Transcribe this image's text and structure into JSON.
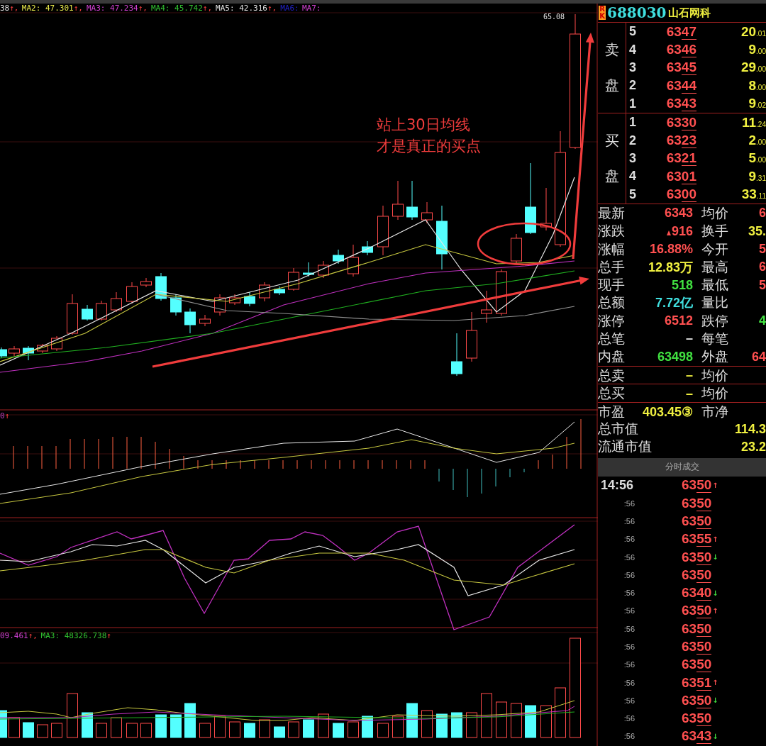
{
  "chart": {
    "legend": [
      {
        "label": "38",
        "mark": "↑,",
        "color": "#e0e0e0"
      },
      {
        "label": "MA2: 47.301",
        "mark": "↑,",
        "color": "#e6e64a"
      },
      {
        "label": "MA3: 47.234",
        "mark": "↑,",
        "color": "#d040d0"
      },
      {
        "label": "MA4: 45.742",
        "mark": "↑,",
        "color": "#30c030"
      },
      {
        "label": "MA5: 42.316",
        "mark": "↑,",
        "color": "#e0e0e0"
      },
      {
        "label": "MA6:",
        "color": "#2020c0"
      },
      {
        "label": "MA7:",
        "color": "#d040d0"
      }
    ],
    "high_label": "65.08",
    "annotation": [
      "站上30日均线",
      "才是真正的买点"
    ],
    "macd_label": "0",
    "macd_mark": "↑",
    "volume_legend": [
      {
        "label": "09.461",
        "mark": "↑,",
        "color": "#d040d0"
      },
      {
        "label": "MA3: 48326.738",
        "mark": "↑",
        "color": "#30c030"
      }
    ]
  },
  "quote": {
    "badge": "RK",
    "code": "688030",
    "name": "山石网科",
    "asks_label": "卖盘",
    "bids_label": "买盘",
    "asks": [
      {
        "level": "5",
        "price": "6347",
        "vol": "20",
        "frac": ".01"
      },
      {
        "level": "4",
        "price": "6346",
        "vol": "9",
        "frac": ".00"
      },
      {
        "level": "3",
        "price": "6345",
        "vol": "29",
        "frac": ".00"
      },
      {
        "level": "2",
        "price": "6344",
        "vol": "8",
        "frac": ".00"
      },
      {
        "level": "1",
        "price": "6343",
        "vol": "9",
        "frac": ".02"
      }
    ],
    "bids": [
      {
        "level": "1",
        "price": "6330",
        "vol": "11",
        "frac": ".24"
      },
      {
        "level": "2",
        "price": "6323",
        "vol": "2",
        "frac": ".00"
      },
      {
        "level": "3",
        "price": "6321",
        "vol": "5",
        "frac": ".00"
      },
      {
        "level": "4",
        "price": "6301",
        "vol": "9",
        "frac": ".31"
      },
      {
        "level": "5",
        "price": "6300",
        "vol": "33",
        "frac": ".11"
      }
    ],
    "stats": [
      {
        "kind": "pair",
        "label": "最新",
        "value": "6343",
        "color": "#ff5050",
        "right": {
          "label": "均价",
          "value": "6",
          "color": "#ff5050"
        }
      },
      {
        "kind": "pair",
        "label": "涨跌",
        "value": "916",
        "up": true,
        "color": "#ff5050",
        "right": {
          "label": "换手",
          "value": "35.",
          "color": "#f0f040"
        }
      },
      {
        "kind": "pair",
        "label": "涨幅",
        "value": "16.88%",
        "color": "#ff5050",
        "right": {
          "label": "今开",
          "value": "5",
          "color": "#ff5050"
        }
      },
      {
        "kind": "pair",
        "label": "总手",
        "value": "12.83万",
        "color": "#f0f040",
        "right": {
          "label": "最高",
          "value": "6",
          "color": "#ff5050"
        }
      },
      {
        "kind": "pair",
        "label": "现手",
        "value": "518",
        "color": "#40e040",
        "right": {
          "label": "最低",
          "value": "5",
          "color": "#ff5050"
        }
      },
      {
        "kind": "pair",
        "label": "总额",
        "value": "7.72亿",
        "color": "#40e0e0",
        "right": {
          "label": "量比"
        }
      },
      {
        "kind": "pair",
        "label": "涨停",
        "value": "6512",
        "color": "#ff5050",
        "right": {
          "label": "跌停",
          "value": "4",
          "color": "#40e040"
        }
      },
      {
        "kind": "pair",
        "label": "总笔",
        "value": "–",
        "color": "#e0e0e0",
        "right": {
          "label": "每笔"
        }
      },
      {
        "kind": "pair",
        "label": "内盘",
        "value": "63498",
        "color": "#40e040",
        "right": {
          "label": "外盘",
          "value": "64",
          "color": "#ff5050"
        }
      },
      {
        "kind": "boxed",
        "label": "总卖",
        "value": "–",
        "color": "#f0f040",
        "right": {
          "label": "均价"
        }
      },
      {
        "kind": "boxed",
        "label": "总买",
        "value": "–",
        "color": "#f0f040",
        "right": {
          "label": "均价"
        }
      },
      {
        "kind": "boxed",
        "label": "市盈",
        "value": "403.45③",
        "color": "#f0f040",
        "right": {
          "label": "市净"
        }
      },
      {
        "kind": "wide",
        "label": "总市值",
        "value": "114.3",
        "color": "#f0f040"
      },
      {
        "kind": "wide",
        "label": "流通市值",
        "value": "23.2",
        "color": "#f0f040"
      }
    ]
  },
  "trades": {
    "title": "分时成交",
    "rows": [
      {
        "time": "14:56",
        "price": "6350",
        "arrow": "↑",
        "color": "#ff5050"
      },
      {
        "time": ":56",
        "price": "6350"
      },
      {
        "time": ":56",
        "price": "6350"
      },
      {
        "time": ":56",
        "price": "6355",
        "arrow": "↑",
        "color": "#ff5050"
      },
      {
        "time": ":56",
        "price": "6350",
        "arrow": "↓",
        "color": "#40e040"
      },
      {
        "time": ":56",
        "price": "6350"
      },
      {
        "time": ":56",
        "price": "6340",
        "arrow": "↓",
        "color": "#40e040"
      },
      {
        "time": ":56",
        "price": "6350",
        "arrow": "↑",
        "color": "#ff5050"
      },
      {
        "time": ":56",
        "price": "6350"
      },
      {
        "time": ":56",
        "price": "6350"
      },
      {
        "time": ":56",
        "price": "6350"
      },
      {
        "time": ":56",
        "price": "6351",
        "arrow": "↑",
        "color": "#ff5050"
      },
      {
        "time": ":56",
        "price": "6350",
        "arrow": "↓",
        "color": "#40e040"
      },
      {
        "time": ":56",
        "price": "6350"
      },
      {
        "time": ":56",
        "price": "6343",
        "arrow": "↓",
        "color": "#40e040"
      }
    ]
  }
}
